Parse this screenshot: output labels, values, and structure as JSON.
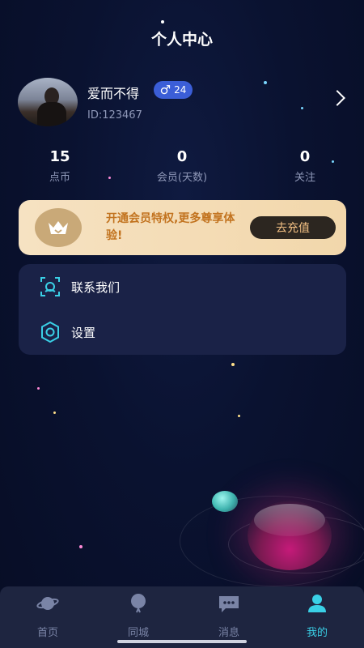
{
  "header": {
    "title": "个人中心"
  },
  "profile": {
    "username": "爱而不得",
    "gender_symbol": "♂",
    "age": "24",
    "user_id": "ID:123467"
  },
  "stats": [
    {
      "value": "15",
      "label": "点币"
    },
    {
      "value": "0",
      "label": "会员(天数)"
    },
    {
      "value": "0",
      "label": "关注"
    }
  ],
  "vip_banner": {
    "text": "开通会员特权,更多尊享体验!",
    "button_label": "去充值"
  },
  "menu": {
    "items": [
      {
        "label": "联系我们",
        "icon": "contact-icon"
      },
      {
        "label": "设置",
        "icon": "settings-gear-icon"
      }
    ]
  },
  "tabbar": {
    "tabs": [
      {
        "label": "首页",
        "icon": "planet-icon"
      },
      {
        "label": "同城",
        "icon": "balloon-icon"
      },
      {
        "label": "消息",
        "icon": "chat-icon"
      },
      {
        "label": "我的",
        "icon": "person-icon",
        "active": true
      }
    ]
  },
  "colors": {
    "background": "#0a1230",
    "accent": "#3ad0e6",
    "vip_text": "#c2731f",
    "badge": "#3b5ed7"
  }
}
